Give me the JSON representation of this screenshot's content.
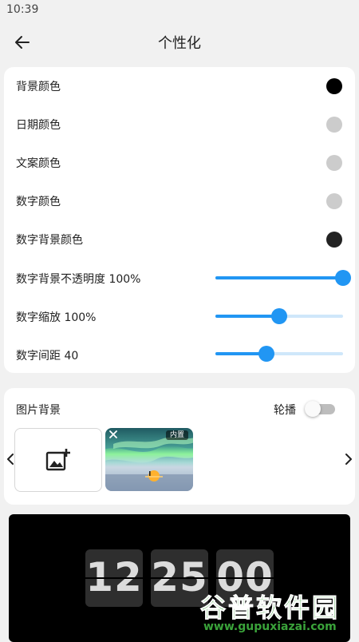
{
  "status_bar": {
    "time": "10:39"
  },
  "app_bar": {
    "title": "个性化"
  },
  "settings": {
    "colors": [
      {
        "label": "背景颜色",
        "color": "#000000"
      },
      {
        "label": "日期颜色",
        "color": "#cccccc"
      },
      {
        "label": "文案颜色",
        "color": "#cccccc"
      },
      {
        "label": "数字颜色",
        "color": "#cccccc"
      },
      {
        "label": "数字背景颜色",
        "color": "#222222"
      }
    ],
    "sliders": [
      {
        "label": "数字背景不透明度 100%",
        "level": 1.0
      },
      {
        "label": "数字缩放 100%",
        "level": 0.5
      },
      {
        "label": "数字间距 40",
        "level": 0.4
      }
    ]
  },
  "image_background": {
    "title": "图片背景",
    "carousel_label": "轮播",
    "carousel_enabled": false,
    "thumbnail_badge": "内置"
  },
  "preview": {
    "hours": "12",
    "minutes": "25",
    "seconds": "00"
  },
  "watermark": {
    "title": "谷普软件园",
    "url": "www.gupuxiazai.com"
  },
  "colors": {
    "accent": "#2196f3",
    "accent_track": "#cfe7fa",
    "watermark": "#3aa33a"
  }
}
